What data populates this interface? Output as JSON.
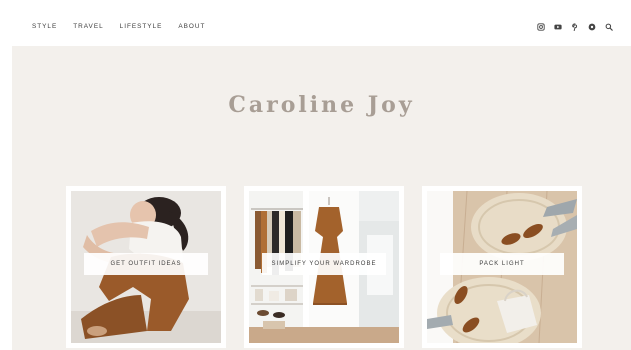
{
  "nav": {
    "items": [
      {
        "label": "STYLE"
      },
      {
        "label": "TRAVEL"
      },
      {
        "label": "LIFESTYLE"
      },
      {
        "label": "ABOUT"
      }
    ]
  },
  "social": {
    "icons": [
      "instagram-icon",
      "youtube-icon",
      "pinterest-icon",
      "circle-icon",
      "search-icon"
    ]
  },
  "hero": {
    "title": "Caroline Joy"
  },
  "cards": [
    {
      "button_label": "GET OUTFIT IDEAS"
    },
    {
      "button_label": "SIMPLIFY YOUR WARDROBE"
    },
    {
      "button_label": "PACK LIGHT"
    }
  ],
  "colors": {
    "hero_bg": "#f3f0ec",
    "title": "#a89e95",
    "text": "#3d3d3d"
  }
}
